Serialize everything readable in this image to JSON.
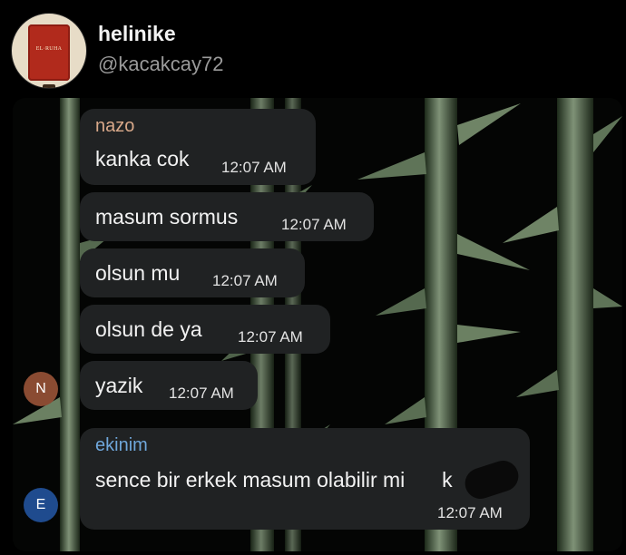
{
  "profile": {
    "display_name": "helinike",
    "username": "@kacakcay72",
    "avatar_logo_text": "EL·RUHA"
  },
  "colors": {
    "bubble": "#202223",
    "sender_nazo": "#d9a98a",
    "sender_ekinim": "#6fa7db",
    "avatar_n": "#8a4b32",
    "avatar_e": "#1f4b8e"
  },
  "messages": [
    {
      "sender": "nazo",
      "text": "kanka cok",
      "time": "12:07 AM"
    },
    {
      "text": "masum sormus",
      "time": "12:07 AM"
    },
    {
      "text": "olsun mu",
      "time": "12:07 AM"
    },
    {
      "text": "olsun de ya",
      "time": "12:07 AM"
    },
    {
      "text": "yazik",
      "time": "12:07 AM"
    },
    {
      "sender": "ekinim",
      "text": "sence bir erkek masum olabilir mi",
      "text_tail": "k",
      "time": "12:07 AM"
    }
  ],
  "avatars": {
    "n": {
      "letter": "N"
    },
    "e": {
      "letter": "E"
    }
  }
}
